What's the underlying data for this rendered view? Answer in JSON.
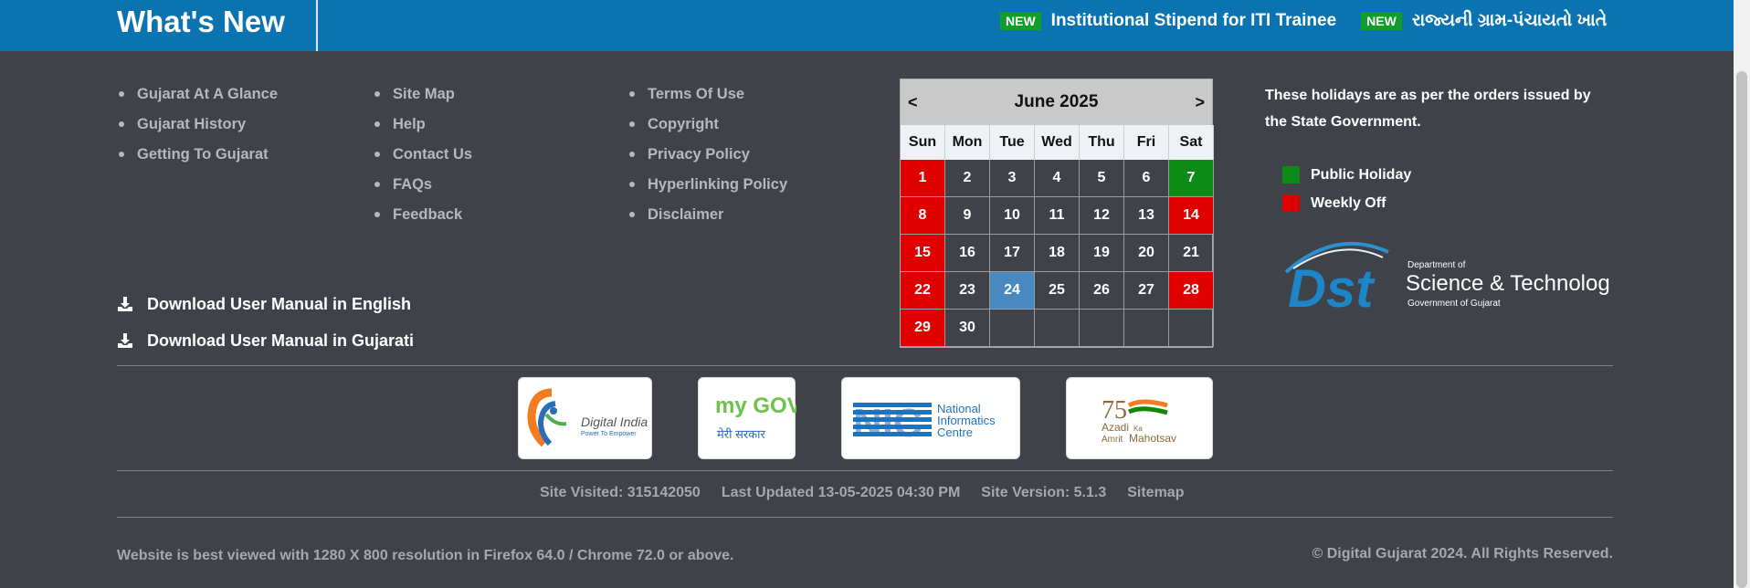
{
  "whats_new": {
    "title": "What's New",
    "items": [
      {
        "badge": "NEW",
        "text": "Institutional Stipend for ITI Trainee"
      },
      {
        "badge": "NEW",
        "text": "રાજ્યની ગ્રામ-પંચાયતો ખાતે"
      }
    ]
  },
  "links": {
    "col1": [
      "Gujarat At A Glance",
      "Gujarat History",
      "Getting To Gujarat"
    ],
    "col2": [
      "Site Map",
      "Help",
      "Contact Us",
      "FAQs",
      "Feedback"
    ],
    "col3": [
      "Terms Of Use",
      "Copyright",
      "Privacy Policy",
      "Hyperlinking Policy",
      "Disclaimer"
    ]
  },
  "downloads": [
    {
      "label": "Download User Manual in English",
      "icon": "download-icon"
    },
    {
      "label": "Download User Manual in Gujarati",
      "icon": "download-icon"
    }
  ],
  "calendar": {
    "prev": "<",
    "next": ">",
    "month_label": "June 2025",
    "days_of_week": [
      "Sun",
      "Mon",
      "Tue",
      "Wed",
      "Thu",
      "Fri",
      "Sat"
    ],
    "weeks": [
      [
        "1",
        "2",
        "3",
        "4",
        "5",
        "6",
        "7"
      ],
      [
        "8",
        "9",
        "10",
        "11",
        "12",
        "13",
        "14"
      ],
      [
        "15",
        "16",
        "17",
        "18",
        "19",
        "20",
        "21"
      ],
      [
        "22",
        "23",
        "24",
        "25",
        "26",
        "27",
        "28"
      ],
      [
        "29",
        "30",
        "",
        "",
        "",
        "",
        ""
      ]
    ],
    "public_holidays": [
      "7"
    ],
    "weekly_offs": [
      "1",
      "8",
      "14",
      "15",
      "22",
      "28",
      "29"
    ],
    "today": "24",
    "colors": {
      "public_holiday": "#0b8a16",
      "weekly_off": "#e00000",
      "today": "#4a88c0"
    }
  },
  "holiday_note": "These holidays are as per the orders issued by the State Government.",
  "legend": [
    {
      "label": "Public Holiday",
      "color": "#0b8a16"
    },
    {
      "label": "Weekly Off",
      "color": "#e00000"
    }
  ],
  "dst_logo": {
    "mark": "Dst",
    "dept": "Department of",
    "name": "Science & Technology",
    "govt": "Government of Gujarat"
  },
  "partners": [
    {
      "name": "Digital India",
      "tagline": "Power To Empower"
    },
    {
      "name": "my GOV",
      "tagline": "मेरी सरकार"
    },
    {
      "name": "NIC",
      "line1": "National",
      "line2": "Informatics",
      "line3": "Centre"
    },
    {
      "name": "Azadi Ka Amrit Mahotsav",
      "mark": "75",
      "line1": "Azadi",
      "line1b": "Ka",
      "line2": "Amrit",
      "line2b": "Mahotsav"
    }
  ],
  "footer": {
    "site_visited": "Site Visited: 315142050",
    "last_updated": "Last Updated 13-05-2025 04:30 PM",
    "site_version": "Site Version: 5.1.3",
    "sitemap": "Sitemap",
    "best_view": "Website is best viewed with 1280 X 800 resolution in Firefox 64.0 / Chrome 72.0 or above.",
    "copyright": "© Digital Gujarat 2024. All Rights Reserved."
  }
}
